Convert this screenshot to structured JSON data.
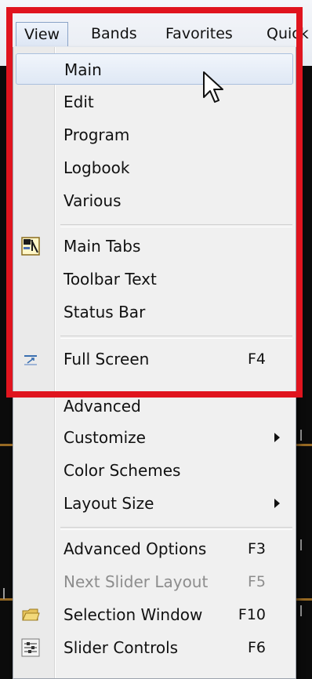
{
  "menubar": {
    "items": [
      "View",
      "Bands",
      "Favorites",
      "Quick"
    ]
  },
  "view_menu": {
    "items": [
      {
        "label": "Main",
        "shortcut": "",
        "state": "hover"
      },
      {
        "label": "Edit",
        "shortcut": ""
      },
      {
        "label": "Program",
        "shortcut": ""
      },
      {
        "label": "Logbook",
        "shortcut": ""
      },
      {
        "label": "Various",
        "shortcut": ""
      },
      {
        "label": "Main Tabs",
        "shortcut": "",
        "icon": "main-tabs-icon"
      },
      {
        "label": "Toolbar Text",
        "shortcut": ""
      },
      {
        "label": "Status Bar",
        "shortcut": ""
      },
      {
        "label": "Full Screen",
        "shortcut": "F4",
        "icon": "full-screen-icon"
      },
      {
        "label": "Advanced",
        "shortcut": ""
      },
      {
        "label": "Customize",
        "shortcut": "",
        "submenu": true
      },
      {
        "label": "Color Schemes",
        "shortcut": ""
      },
      {
        "label": "Layout Size",
        "shortcut": "",
        "submenu": true
      },
      {
        "label": "Advanced Options",
        "shortcut": "F3"
      },
      {
        "label": "Next Slider Layout",
        "shortcut": "F5",
        "state": "disabled"
      },
      {
        "label": "Selection Window",
        "shortcut": "F10",
        "icon": "folder-icon"
      },
      {
        "label": "Slider Controls",
        "shortcut": "F6",
        "icon": "slider-controls-icon"
      }
    ]
  },
  "colors": {
    "highlight_border": "#e0141e",
    "menu_background": "#f0f0f0",
    "hover_background": "#dfe8f5",
    "disabled_text": "#8d8d8d"
  }
}
